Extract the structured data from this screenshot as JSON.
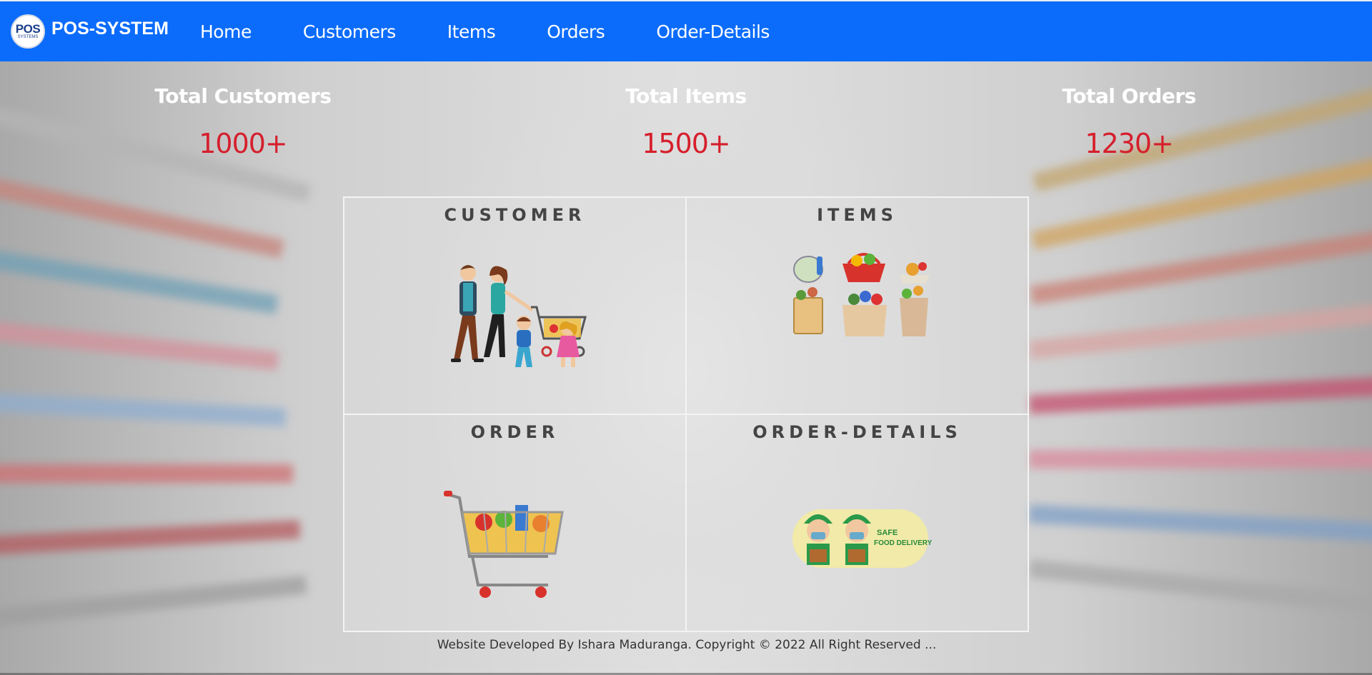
{
  "nav": {
    "logo_text": "POS",
    "logo_subtext": "SYSTEMS",
    "brand": "POS-SYSTEM",
    "links": [
      "Home",
      "Customers",
      "Items",
      "Orders",
      "Order-Details"
    ]
  },
  "stats": [
    {
      "label": "Total Customers",
      "value": "1000+"
    },
    {
      "label": "Total Items",
      "value": "1500+"
    },
    {
      "label": "Total Orders",
      "value": "1230+"
    }
  ],
  "cards": [
    {
      "title": "CUSTOMER",
      "icon": "family-shopping-icon"
    },
    {
      "title": "ITEMS",
      "icon": "grocery-items-icon"
    },
    {
      "title": "ORDER",
      "icon": "shopping-cart-icon"
    },
    {
      "title": "ORDER-DETAILS",
      "icon": "food-delivery-icon"
    }
  ],
  "footer": "Website Developed By Ishara Maduranga. Copyright © 2022 All Right Reserved ...",
  "colors": {
    "nav_bg": "#0b6cfb",
    "stat_value": "#d61f2c",
    "card_title": "#444444"
  }
}
